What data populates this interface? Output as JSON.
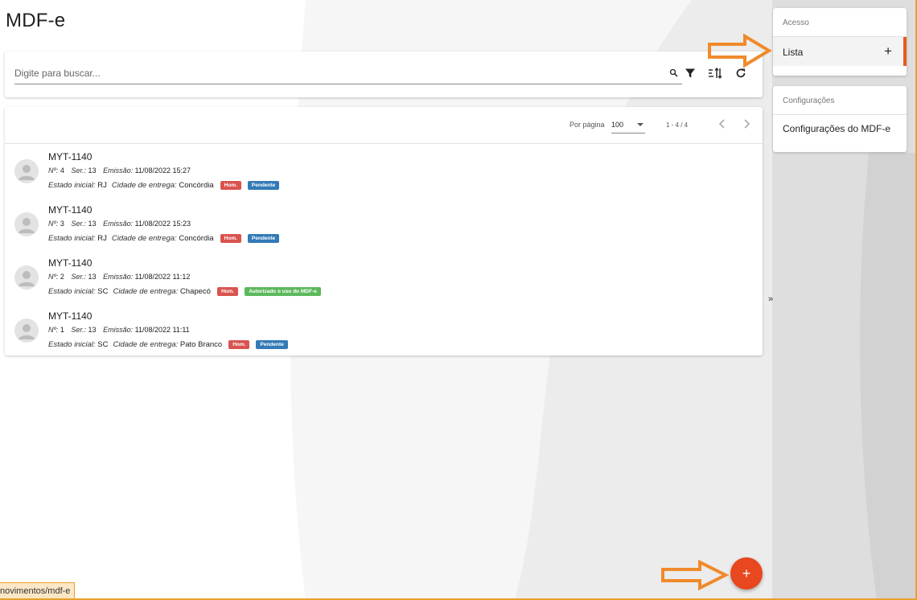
{
  "page": {
    "title": "MDF-e",
    "status_url": "novimentos/mdf-e"
  },
  "search": {
    "placeholder": "Digite para buscar...",
    "value": ""
  },
  "toolbar": {
    "search_icon": "search-icon",
    "filter_icon": "filter-icon",
    "sort_icon": "sort-icon",
    "refresh_icon": "refresh-icon"
  },
  "paginator": {
    "per_page_label": "Por página",
    "per_page_value": "100",
    "range_label": "1 - 4 / 4"
  },
  "labels": {
    "numero": "Nº:",
    "serie": "Ser.:",
    "emissao": "Emissão:",
    "estado_inicial": "Estado inicial:",
    "cidade_entrega": "Cidade de entrega:"
  },
  "items": [
    {
      "title": "MYT-1140",
      "numero": "4",
      "serie": "13",
      "emissao": "11/08/2022 15:27",
      "estado": "RJ",
      "cidade": "Concórdia",
      "ambiente": "Hom.",
      "status": "Pendente"
    },
    {
      "title": "MYT-1140",
      "numero": "3",
      "serie": "13",
      "emissao": "11/08/2022 15:23",
      "estado": "RJ",
      "cidade": "Concórdia",
      "ambiente": "Hom.",
      "status": "Pendente"
    },
    {
      "title": "MYT-1140",
      "numero": "2",
      "serie": "13",
      "emissao": "11/08/2022 11:12",
      "estado": "SC",
      "cidade": "Chapecó",
      "ambiente": "Hom.",
      "status": "Autorizado o uso do MDF-e"
    },
    {
      "title": "MYT-1140",
      "numero": "1",
      "serie": "13",
      "emissao": "11/08/2022 11:11",
      "estado": "SC",
      "cidade": "Pato Branco",
      "ambiente": "Hom.",
      "status": "Pendente"
    }
  ],
  "sidebar": {
    "acesso": {
      "header": "Acesso",
      "item_label": "Lista",
      "plus": "+"
    },
    "configuracoes": {
      "header": "Configurações",
      "item_label": "Configurações do MDF-e"
    },
    "collapse": "»"
  },
  "fab": {
    "label": "+"
  },
  "colors": {
    "accent": "#e8471f",
    "active_bar": "#e85a1f",
    "badge_hom": "#d9534f",
    "badge_pendente": "#337ab7",
    "badge_autorizado": "#5cb85c",
    "annotation_arrow": "#f08a2c"
  }
}
